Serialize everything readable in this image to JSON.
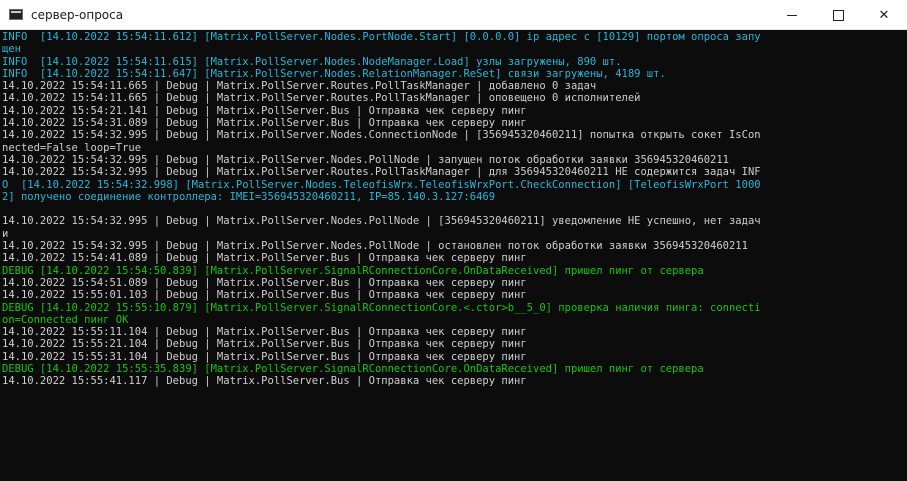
{
  "window": {
    "title": "сервер-опроса",
    "icon": "console-app-icon",
    "controls": {
      "minimize": "—",
      "maximize": "☐",
      "close": "✕"
    }
  },
  "colors": {
    "info": "#28b6d8",
    "debug": "#cfcfcf",
    "green": "#16c60c",
    "background": "#0c0c0c"
  },
  "console": {
    "lines": [
      {
        "text": "INFO  [14.10.2022 15:54:11.612] [Matrix.PollServer.Nodes.PortNode.Start] [0.0.0.0] ip адрес с [10129] портом опроса запу",
        "kind": "info"
      },
      {
        "text": "щен",
        "kind": "info"
      },
      {
        "text": "INFO  [14.10.2022 15:54:11.615] [Matrix.PollServer.Nodes.NodeManager.Load] узлы загружены, 890 шт.",
        "kind": "info"
      },
      {
        "text": "INFO  [14.10.2022 15:54:11.647] [Matrix.PollServer.Nodes.RelationManager.ReSet] связи загружены, 4189 шт.",
        "kind": "info"
      },
      {
        "text": "14.10.2022 15:54:11.665 | Debug | Matrix.PollServer.Routes.PollTaskManager | добавлено 0 задач",
        "kind": "debug"
      },
      {
        "text": "14.10.2022 15:54:11.665 | Debug | Matrix.PollServer.Routes.PollTaskManager | оповещено 0 исполнителей",
        "kind": "debug"
      },
      {
        "text": "14.10.2022 15:54:21.141 | Debug | Matrix.PollServer.Bus | Отправка чек серверу пинг",
        "kind": "debug"
      },
      {
        "text": "14.10.2022 15:54:31.089 | Debug | Matrix.PollServer.Bus | Отправка чек серверу пинг",
        "kind": "debug"
      },
      {
        "text": "14.10.2022 15:54:32.995 | Debug | Matrix.PollServer.Nodes.ConnectionNode | [356945320460211] попытка открыть сокет IsCon",
        "kind": "debug"
      },
      {
        "text": "nected=False loop=True",
        "kind": "debug"
      },
      {
        "text": "14.10.2022 15:54:32.995 | Debug | Matrix.PollServer.Nodes.PollNode | запущен поток обработки заявки 356945320460211",
        "kind": "debug"
      },
      {
        "text": "14.10.2022 15:54:32.995 | Debug | Matrix.PollServer.Routes.PollTaskManager | для 356945320460211 НЕ содержится задач INF",
        "kind": "debug"
      },
      {
        "text": "O  [14.10.2022 15:54:32.998] [Matrix.PollServer.Nodes.TeleofisWrx.TeleofisWrxPort.CheckConnection] [TeleofisWrxPort 1000",
        "kind": "info"
      },
      {
        "text": "2] получено соединение контроллера: IMEI=356945320460211, IP=85.140.3.127:6469",
        "kind": "info"
      },
      {
        "text": "",
        "kind": "debug"
      },
      {
        "text": "14.10.2022 15:54:32.995 | Debug | Matrix.PollServer.Nodes.PollNode | [356945320460211] уведомление НЕ успешно, нет задач",
        "kind": "debug"
      },
      {
        "text": "и",
        "kind": "debug"
      },
      {
        "text": "14.10.2022 15:54:32.995 | Debug | Matrix.PollServer.Nodes.PollNode | остановлен поток обработки заявки 356945320460211",
        "kind": "debug"
      },
      {
        "text": "14.10.2022 15:54:41.089 | Debug | Matrix.PollServer.Bus | Отправка чек серверу пинг",
        "kind": "debug"
      },
      {
        "text": "DEBUG [14.10.2022 15:54:50.839] [Matrix.PollServer.SignalRConnectionCore.OnDataReceived] пришел пинг от сервера",
        "kind": "green"
      },
      {
        "text": "14.10.2022 15:54:51.089 | Debug | Matrix.PollServer.Bus | Отправка чек серверу пинг",
        "kind": "debug"
      },
      {
        "text": "14.10.2022 15:55:01.103 | Debug | Matrix.PollServer.Bus | Отправка чек серверу пинг",
        "kind": "debug"
      },
      {
        "text": "DEBUG [14.10.2022 15:55:10.879] [Matrix.PollServer.SignalRConnectionCore.<.ctor>b__5_0] проверка наличия пинга: connecti",
        "kind": "green"
      },
      {
        "text": "on=Connected пинг OK",
        "kind": "green"
      },
      {
        "text": "14.10.2022 15:55:11.104 | Debug | Matrix.PollServer.Bus | Отправка чек серверу пинг",
        "kind": "debug"
      },
      {
        "text": "14.10.2022 15:55:21.104 | Debug | Matrix.PollServer.Bus | Отправка чек серверу пинг",
        "kind": "debug"
      },
      {
        "text": "14.10.2022 15:55:31.104 | Debug | Matrix.PollServer.Bus | Отправка чек серверу пинг",
        "kind": "debug"
      },
      {
        "text": "DEBUG [14.10.2022 15:55:35.839] [Matrix.PollServer.SignalRConnectionCore.OnDataReceived] пришел пинг от сервера",
        "kind": "green"
      },
      {
        "text": "14.10.2022 15:55:41.117 | Debug | Matrix.PollServer.Bus | Отправка чек серверу пинг",
        "kind": "debug"
      }
    ]
  }
}
